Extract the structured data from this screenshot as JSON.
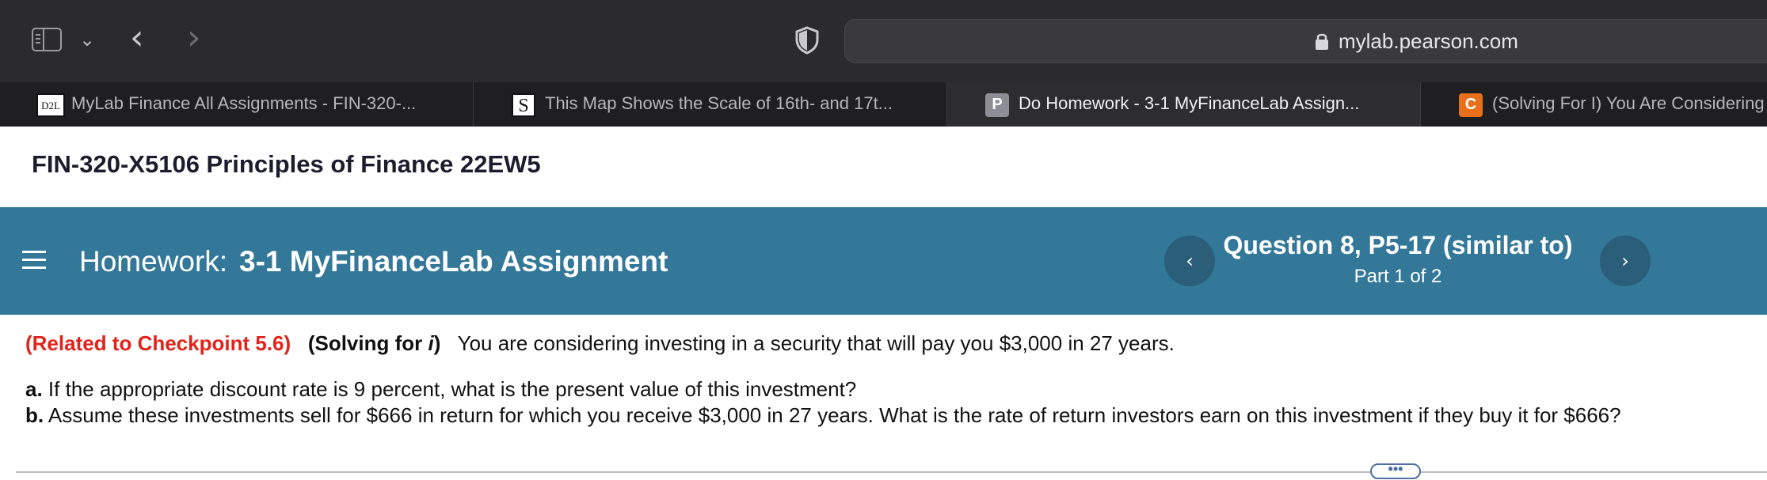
{
  "browser": {
    "url": "mylab.pearson.com",
    "tabs": [
      {
        "favicon": "D2L",
        "title": "MyLab Finance All Assignments - FIN-320-..."
      },
      {
        "favicon": "S",
        "title": "This Map Shows the Scale of 16th- and 17t..."
      },
      {
        "favicon": "P",
        "title": "Do Homework - 3-1 MyFinanceLab Assign..."
      },
      {
        "favicon": "C",
        "title": "(Solving For I) You Are Considering"
      }
    ]
  },
  "course": {
    "title": "FIN-320-X5106 Principles of Finance 22EW5"
  },
  "homework": {
    "prefix": "Homework:",
    "title": "3-1 MyFinanceLab Assignment",
    "question_title": "Question 8, P5-17 (similar to)",
    "question_part": "Part 1 of 2",
    "prev_glyph": "‹",
    "next_glyph": "›"
  },
  "question": {
    "related": "(Related to Checkpoint 5.6)",
    "solving": "(Solving for ",
    "solving_var": "i",
    "solving_close": ")",
    "text": "You are considering investing in a security that will pay you $3,000 in 27 years.",
    "part_a_label": "a.",
    "part_a": "If the appropriate discount rate is 9 percent, what is the present value of this investment?",
    "part_b_label": "b.",
    "part_b": "Assume these investments sell for $666 in return for which you receive $3,000 in 27 years.  What is the rate of return investors earn on this investment if they buy it for $666?"
  },
  "more_label": "•••",
  "colors": {
    "hwbar": "#337898",
    "related": "#e2231a",
    "tab_active": "#2d2d30"
  }
}
